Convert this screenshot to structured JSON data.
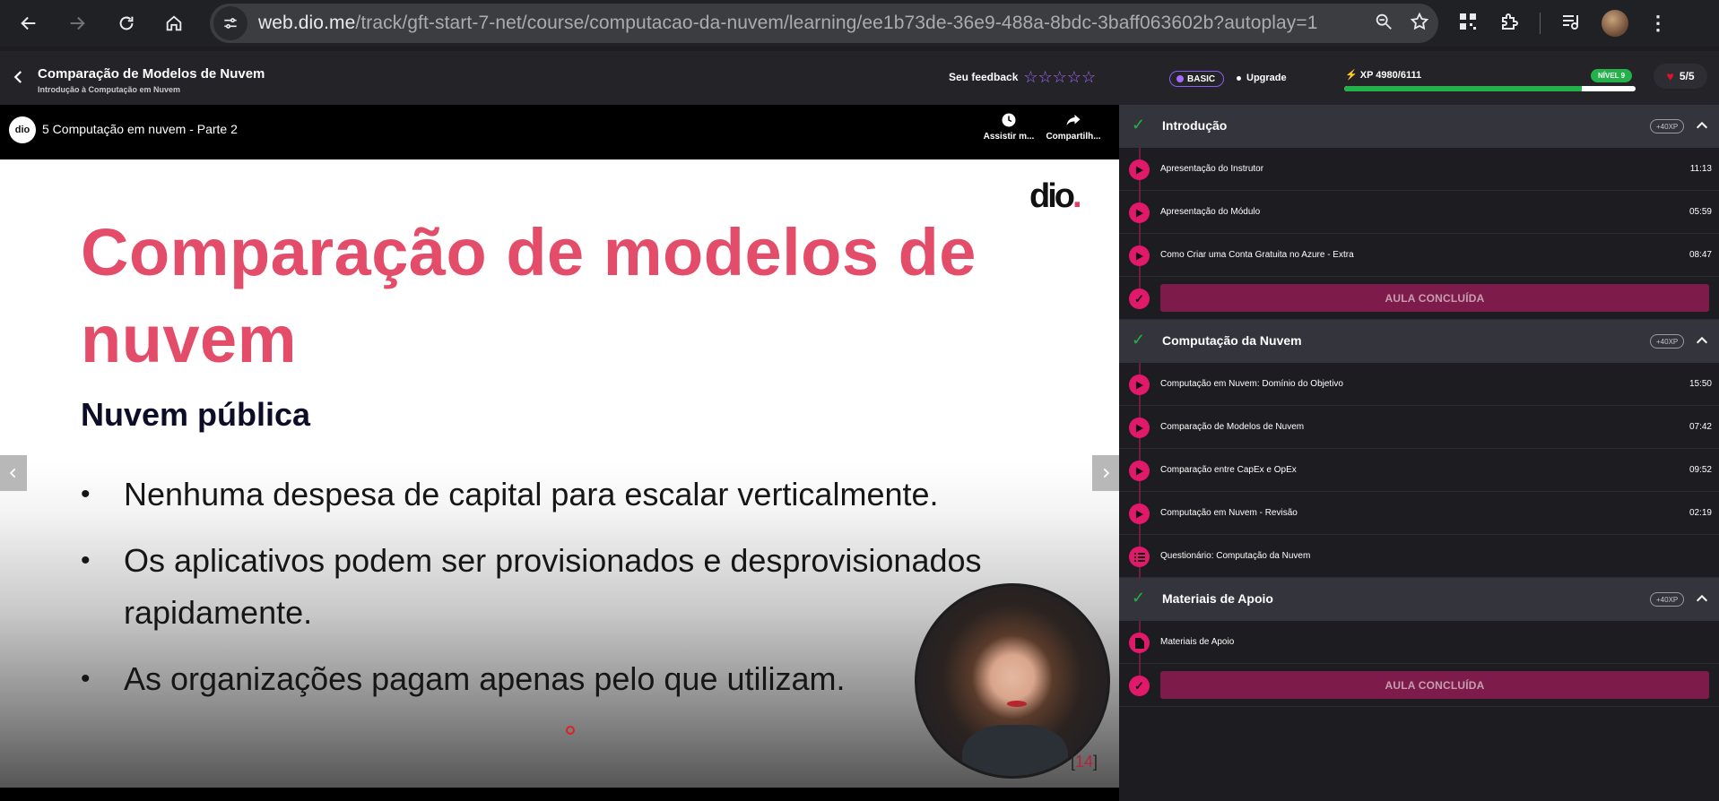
{
  "browser": {
    "url_host": "web.dio.me",
    "url_path": "/track/gft-start-7-net/course/computacao-da-nuvem/learning/ee1b73de-36e9-488a-8bdc-3baff063602b?autoplay=1"
  },
  "course": {
    "title": "Comparação de Modelos de Nuvem",
    "subtitle": "Introdução à Computação em Nuvem",
    "feedback_label": "Seu feedback",
    "stars": [
      "☆",
      "☆",
      "☆",
      "☆",
      "☆"
    ]
  },
  "video": {
    "logo": "dio",
    "title": "5 Computação em nuvem - Parte 2",
    "watch_later": "Assistir m...",
    "share": "Compartilh..."
  },
  "slide": {
    "logo": "dio",
    "logo_dot": ".",
    "title": "Comparação de modelos de nuvem",
    "subtitle": "Nuvem pública",
    "bullets": [
      "Nenhuma despesa de capital para escalar verticalmente.",
      "Os aplicativos podem ser provisionados e desprovisionados rapidamente.",
      "As organizações pagam apenas pelo que utilizam."
    ],
    "page_open": "[",
    "page_number": "14",
    "page_close": "]"
  },
  "account": {
    "plan": "BASIC",
    "upgrade": "Upgrade",
    "xp_label": "XP 4980/6111",
    "xp_progress": 0.815,
    "level": "NÍVEL 9",
    "lives": "5/5"
  },
  "sections": [
    {
      "title": "Introdução",
      "xp": "+40XP",
      "lessons": [
        {
          "title": "Apresentação do Instrutor",
          "duration": "11:13"
        },
        {
          "title": "Apresentação do Módulo",
          "duration": "05:59"
        },
        {
          "title": "Como Criar uma Conta Gratuita no Azure - Extra",
          "duration": "08:47"
        }
      ],
      "done_label": "AULA CONCLUÍDA"
    },
    {
      "title": "Computação da Nuvem",
      "xp": "+40XP",
      "lessons": [
        {
          "title": "Computação em Nuvem: Domínio do Objetivo",
          "duration": "15:50"
        },
        {
          "title": "Comparação de Modelos de Nuvem",
          "duration": "07:42"
        },
        {
          "title": "Comparação entre CapEx e OpEx",
          "duration": "09:52"
        },
        {
          "title": "Computação em Nuvem - Revisão",
          "duration": "02:19"
        }
      ],
      "quiz": "Questionário: Computação da Nuvem"
    },
    {
      "title": "Materiais de Apoio",
      "xp": "+40XP",
      "material": "Materiais de Apoio",
      "done_label": "AULA CONCLUÍDA"
    }
  ],
  "colors": {
    "accent_pink": "#e2196b",
    "slide_title": "#e44d69",
    "success_green": "#25b14a",
    "plan_purple": "#8a5cf6"
  }
}
